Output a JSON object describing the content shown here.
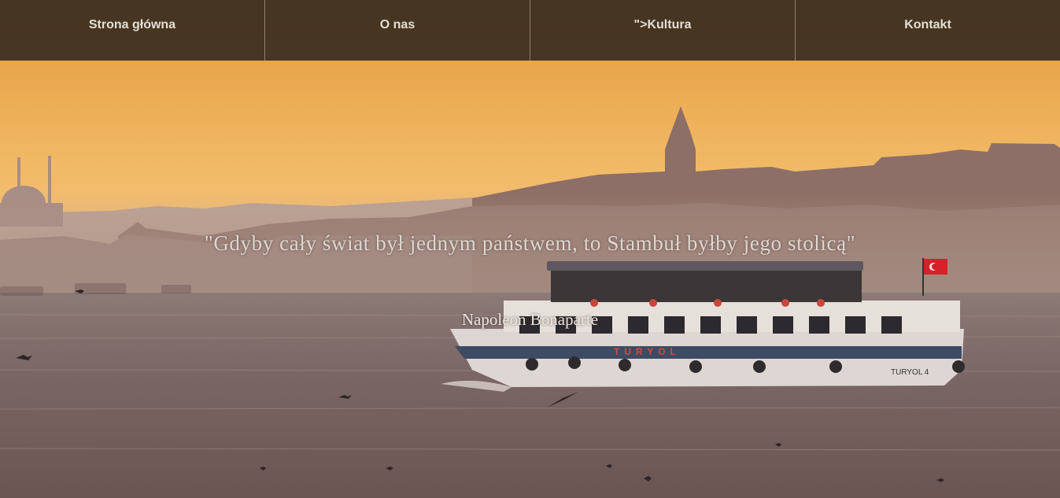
{
  "nav": {
    "items": [
      {
        "label": "Strona główna"
      },
      {
        "label": "O nas"
      },
      {
        "label": "\">Kultura"
      },
      {
        "label": "Kontakt"
      }
    ]
  },
  "hero": {
    "quote": "\"Gdyby cały świat był jednym państwem, to Stambuł byłby jego stolicą\"",
    "author": "Napoleon Bonaparte",
    "ship_name": "TURYOL",
    "ship_name_stern": "TURYOL 4",
    "flag_icon": "turkish-flag-icon"
  },
  "colors": {
    "nav_bg": "#3a2d20",
    "nav_text": "#e4ded6",
    "sky_top": "#e8a23e",
    "sky_horizon": "#f6c987",
    "sea": "#7d6867",
    "quote_text": "#ddd7d2"
  }
}
